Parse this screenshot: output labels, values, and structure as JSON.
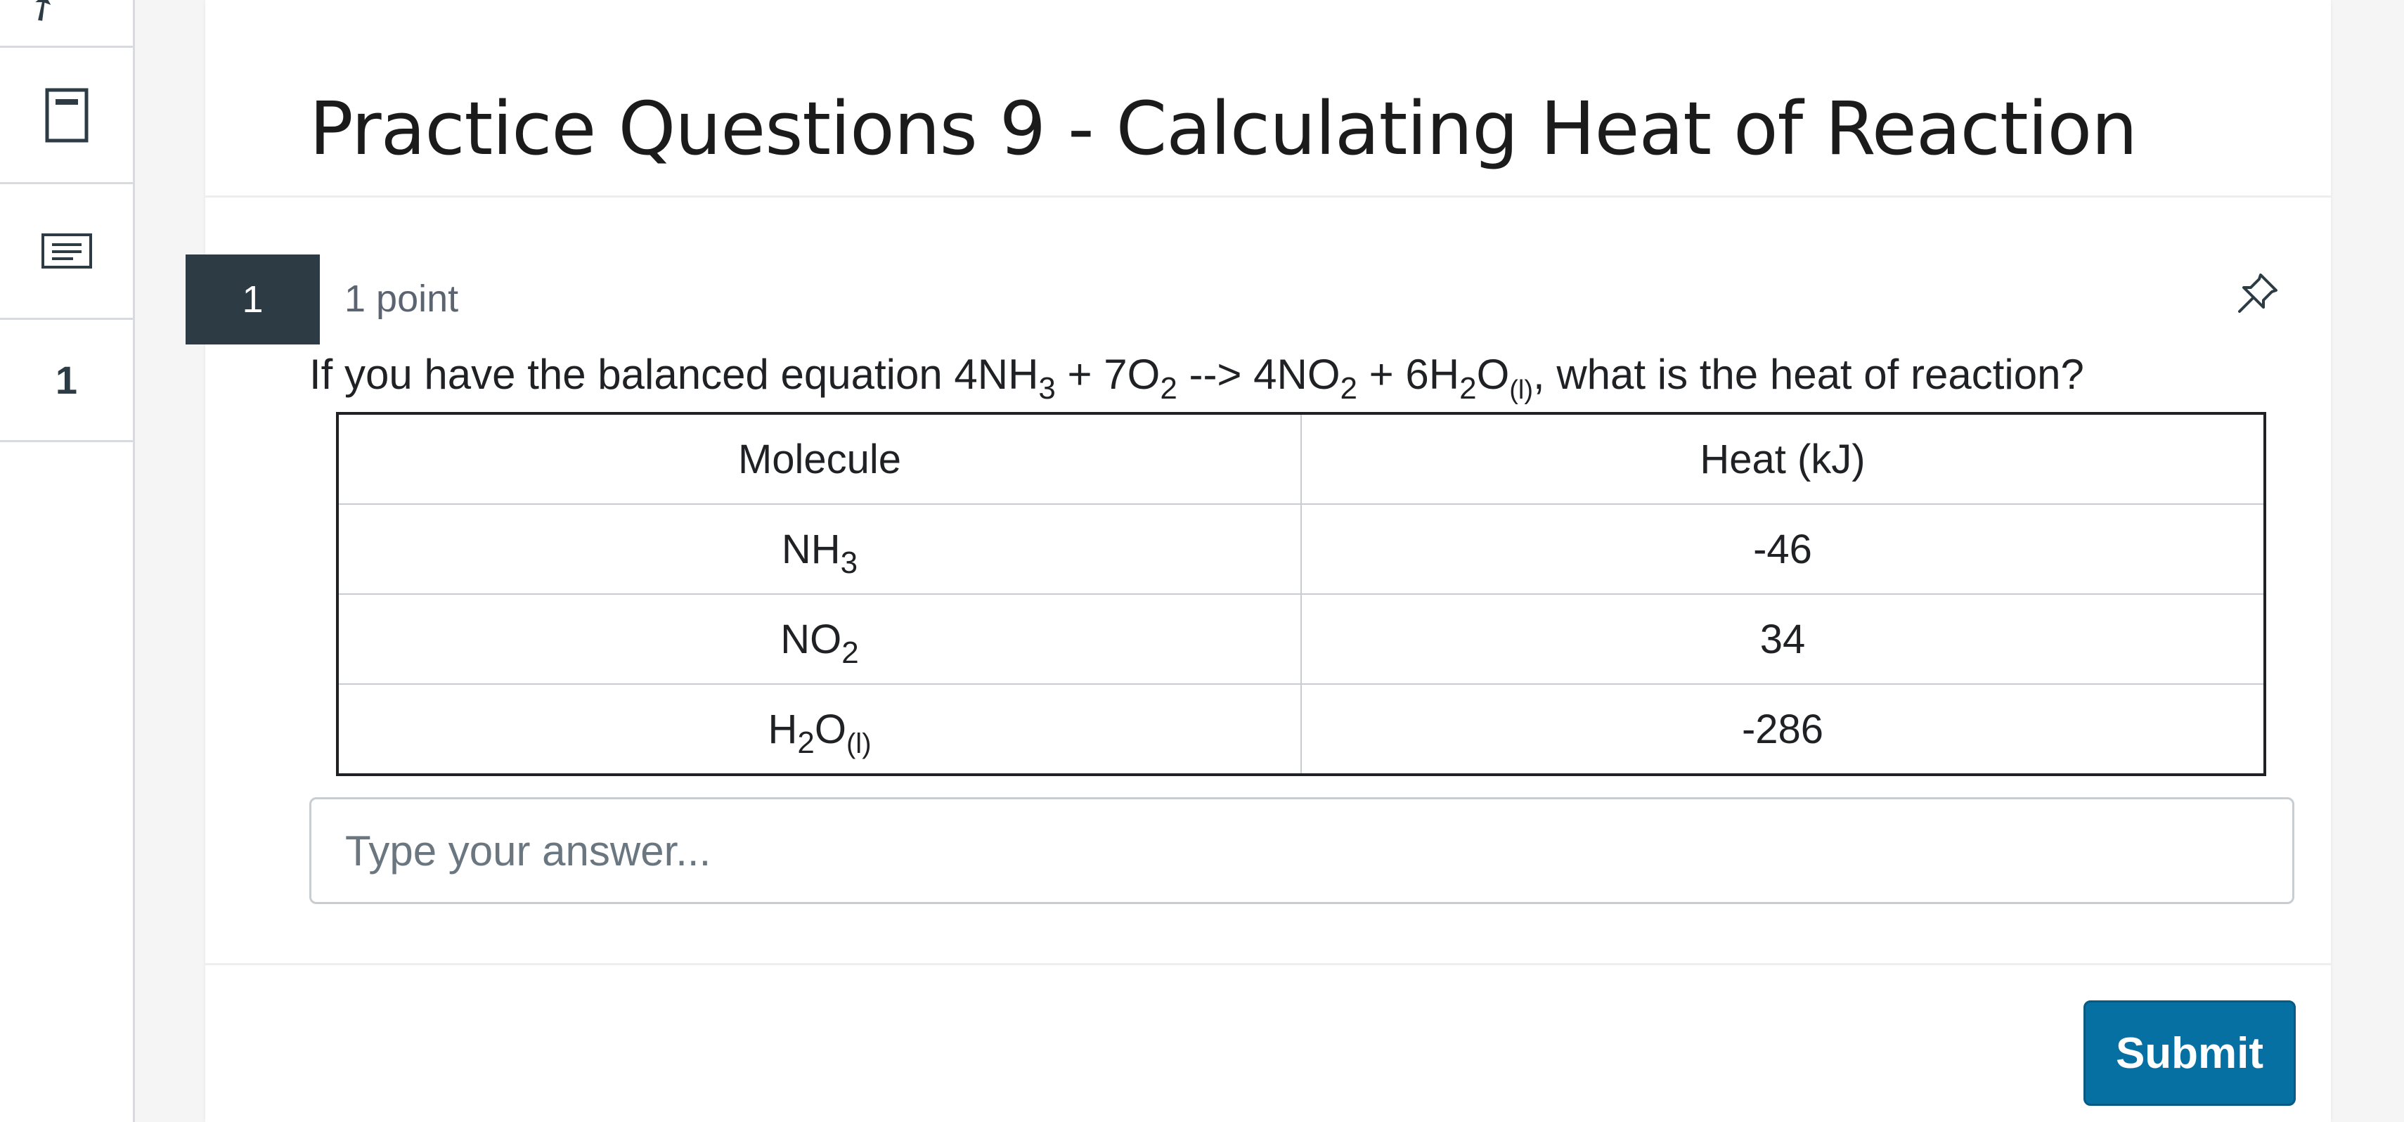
{
  "sidebar": {
    "top_icon": "arrow-icon",
    "items": [
      {
        "icon": "calculator-icon"
      },
      {
        "icon": "notes-icon"
      },
      {
        "label": "1"
      }
    ]
  },
  "page": {
    "title": "Practice Questions 9 - Calculating Heat of Reaction"
  },
  "question": {
    "number": "1",
    "points": "1 point",
    "pin_icon": "pin-icon",
    "text": {
      "lead": "If you have the balanced equation 4NH",
      "s1": "3",
      "p2": " + 7O",
      "s2": "2",
      "p3": " --> 4NO",
      "s3": "2",
      "p4": " + 6H",
      "s4": "2",
      "p5": "O",
      "s5": "(l)",
      "tail": ", what is the heat of reaction?"
    },
    "table": {
      "headers": [
        "Molecule",
        "Heat (kJ)"
      ],
      "rows": [
        {
          "base": "NH",
          "sub": "3",
          "after": "",
          "sub2": "",
          "value": "-46"
        },
        {
          "base": "NO",
          "sub": "2",
          "after": "",
          "sub2": "",
          "value": "34"
        },
        {
          "base": "H",
          "sub": "2",
          "after": "O",
          "sub2": "(l)",
          "value": "-286"
        }
      ]
    },
    "answer_placeholder": "Type your answer..."
  },
  "footer": {
    "submit_label": "Submit"
  },
  "colors": {
    "badge": "#2d3b45",
    "submit": "#0770a3",
    "muted_text": "#5b6470"
  }
}
